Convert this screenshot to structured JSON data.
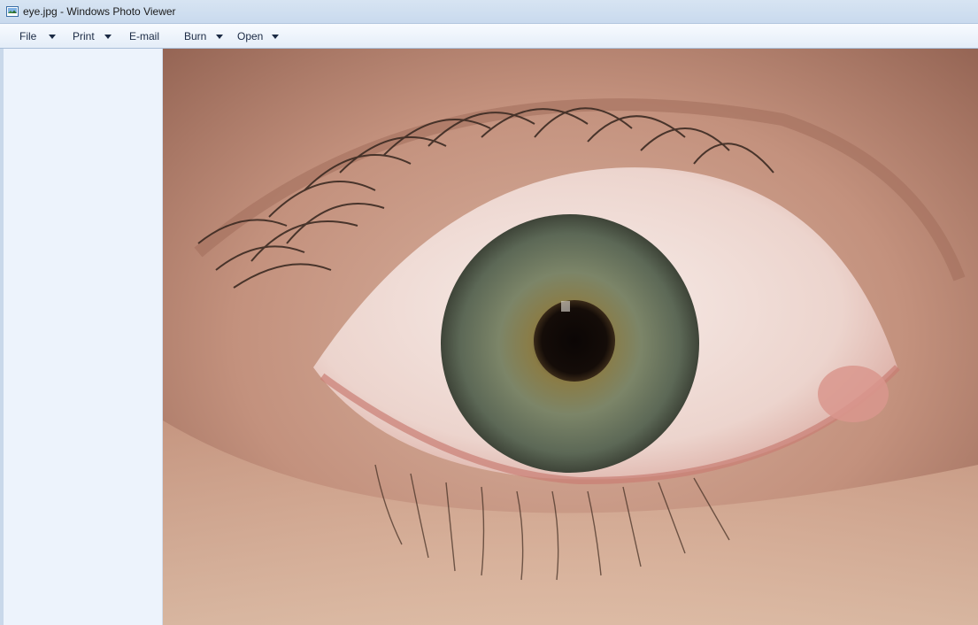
{
  "window": {
    "title": "eye.jpg - Windows Photo Viewer",
    "icon": "photo-viewer-icon"
  },
  "menu": {
    "file": "File",
    "print": "Print",
    "email": "E-mail",
    "burn": "Burn",
    "open": "Open"
  },
  "photo": {
    "subject": "eye-photo",
    "colors": {
      "skin": "#c79a84",
      "sclera": "#efe2dd",
      "iris": "#6f7a62",
      "pupil": "#100a08"
    }
  }
}
